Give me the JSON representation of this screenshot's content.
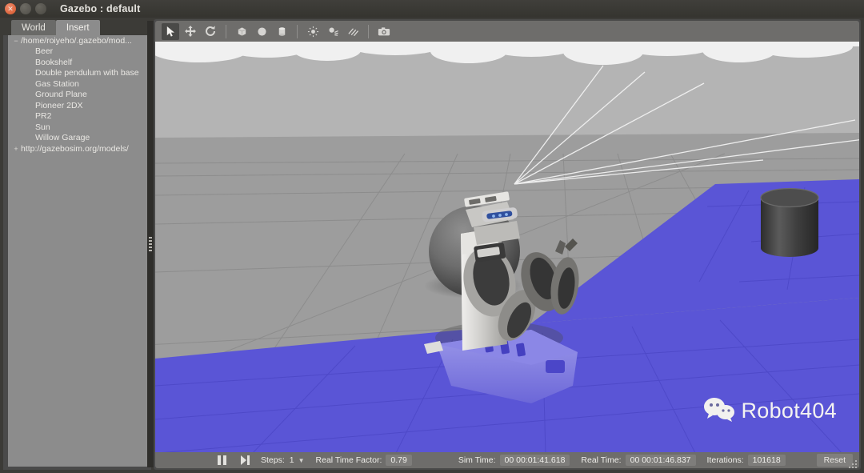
{
  "window": {
    "title": "Gazebo : default",
    "controls": [
      {
        "name": "close-button",
        "glyph": "✕"
      },
      {
        "name": "minimize-button",
        "glyph": ""
      },
      {
        "name": "maximize-button",
        "glyph": ""
      }
    ]
  },
  "left_panel": {
    "tabs": [
      {
        "label": "World",
        "active": false
      },
      {
        "label": "Insert",
        "active": true
      }
    ],
    "tree": [
      {
        "label": "/home/roiyeho/.gazebo/mod...",
        "level": 0,
        "expander": "−"
      },
      {
        "label": "Beer",
        "level": 1,
        "expander": ""
      },
      {
        "label": "Bookshelf",
        "level": 1,
        "expander": ""
      },
      {
        "label": "Double pendulum with base",
        "level": 1,
        "expander": ""
      },
      {
        "label": "Gas Station",
        "level": 1,
        "expander": ""
      },
      {
        "label": "Ground Plane",
        "level": 1,
        "expander": ""
      },
      {
        "label": "Pioneer 2DX",
        "level": 1,
        "expander": ""
      },
      {
        "label": "PR2",
        "level": 1,
        "expander": ""
      },
      {
        "label": "Sun",
        "level": 1,
        "expander": ""
      },
      {
        "label": "Willow Garage",
        "level": 1,
        "expander": ""
      },
      {
        "label": "http://gazebosim.org/models/",
        "level": 0,
        "expander": "+"
      }
    ]
  },
  "toolbar": {
    "items": [
      {
        "name": "select-mode-icon",
        "selected": true
      },
      {
        "name": "translate-mode-icon",
        "selected": false
      },
      {
        "name": "rotate-mode-icon",
        "selected": false
      },
      {
        "name": "separator-1",
        "selected": false
      },
      {
        "name": "insert-box-icon",
        "selected": false
      },
      {
        "name": "insert-sphere-icon",
        "selected": false
      },
      {
        "name": "insert-cylinder-icon",
        "selected": false
      },
      {
        "name": "separator-2",
        "selected": false
      },
      {
        "name": "point-light-icon",
        "selected": false
      },
      {
        "name": "spot-light-icon",
        "selected": false
      },
      {
        "name": "directional-light-icon",
        "selected": false
      },
      {
        "name": "separator-3",
        "selected": false
      },
      {
        "name": "screenshot-camera-icon",
        "selected": false
      }
    ]
  },
  "statusbar": {
    "pause_icon": "pause-icon",
    "step_icon": "step-forward-icon",
    "steps_label": "Steps:",
    "steps_value": "1",
    "rtf_label": "Real Time Factor:",
    "rtf_value": "0.79",
    "sim_time_label": "Sim Time:",
    "sim_time_value": "00 00:01:41.618",
    "real_time_label": "Real Time:",
    "real_time_value": "00 00:01:46.837",
    "iterations_label": "Iterations:",
    "iterations_value": "101618",
    "reset_label": "Reset"
  },
  "scene": {
    "sky_color": "#b4b4b4",
    "ground_grey_color": "#9d9d9d",
    "ground_blue_color": "#5a55d6",
    "grid_color": "#8a8a8a",
    "objects": [
      {
        "name": "sphere-object",
        "shape": "sphere",
        "color": "#6e6e6e"
      },
      {
        "name": "cylinder-object",
        "shape": "cylinder",
        "color": "#3d3d3d"
      },
      {
        "name": "pr2-robot",
        "shape": "robot",
        "color": "#d9d8d5"
      }
    ],
    "laser_rays": {
      "name": "laser-scan-rays",
      "color": "#f2f2f2",
      "count": 5
    }
  },
  "watermark": {
    "text": "Robot404",
    "icon": "wechat-icon"
  }
}
